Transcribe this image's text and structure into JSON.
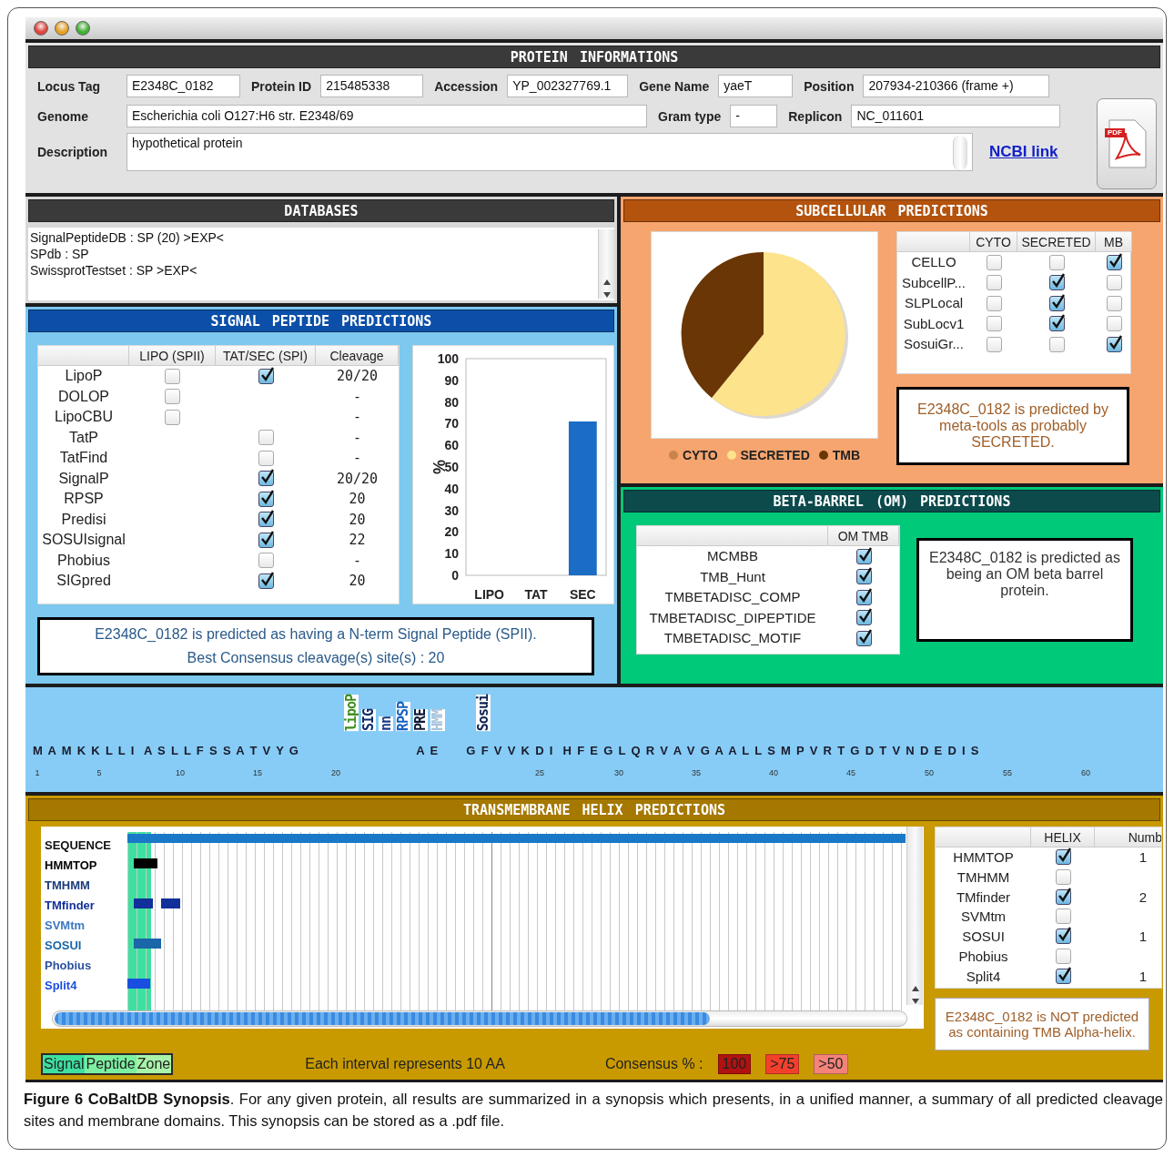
{
  "protein_info": {
    "title": "PROTEIN INFORMATIONS",
    "rows": [
      {
        "fields": [
          {
            "label": "Locus Tag",
            "value": "E2348C_0182"
          },
          {
            "label": "Protein ID",
            "value": "215485338"
          },
          {
            "label": "Accession",
            "value": "YP_002327769.1"
          },
          {
            "label": "Gene Name",
            "value": "yaeT"
          },
          {
            "label": "Position",
            "value": "207934-210366 (frame +)"
          }
        ]
      },
      {
        "fields": [
          {
            "label": "Genome",
            "value": "Escherichia coli O127:H6 str. E2348/69"
          },
          {
            "label": "Gram type",
            "value": "-"
          },
          {
            "label": "Replicon",
            "value": "NC_011601"
          }
        ]
      }
    ],
    "description": {
      "label": "Description",
      "value": "hypothetical protein"
    },
    "link": "NCBI link",
    "pdf_badge": "PDF"
  },
  "databases": {
    "title": "DATABASES",
    "lines": [
      "SignalPeptideDB : SP (20) >EXP<",
      "SPdb : SP",
      "SwissprotTestset : SP >EXP<"
    ]
  },
  "signal_peptide": {
    "title": "SIGNAL PEPTIDE PREDICTIONS",
    "columns": [
      "LIPO (SPII)",
      "TAT/SEC (SPI)",
      "Cleavage"
    ],
    "rows": [
      {
        "name": "LipoP",
        "lipo": false,
        "tat_sec": true,
        "cleavage": "20/20"
      },
      {
        "name": "DOLOP",
        "lipo": false,
        "cleavage": "-"
      },
      {
        "name": "LipoCBU",
        "lipo": false,
        "cleavage": "-"
      },
      {
        "name": "TatP",
        "tat_sec": false,
        "cleavage": "-"
      },
      {
        "name": "TatFind",
        "tat_sec": false,
        "cleavage": "-"
      },
      {
        "name": "SignalP",
        "tat_sec": true,
        "cleavage": "20/20"
      },
      {
        "name": "RPSP",
        "tat_sec": true,
        "cleavage": "20"
      },
      {
        "name": "Predisi",
        "tat_sec": true,
        "cleavage": "20"
      },
      {
        "name": "SOSUIsignal",
        "tat_sec": true,
        "cleavage": "22"
      },
      {
        "name": "Phobius",
        "tat_sec": false,
        "cleavage": "-"
      },
      {
        "name": "SIGpred",
        "tat_sec": true,
        "cleavage": "20"
      }
    ],
    "chart_data": {
      "type": "bar",
      "ylabel": "%",
      "categories": [
        "LIPO",
        "TAT",
        "SEC"
      ],
      "values": [
        0,
        0,
        71
      ],
      "ylim": [
        0,
        100
      ],
      "yticks": [
        0,
        10,
        20,
        30,
        40,
        50,
        60,
        70,
        80,
        90,
        100
      ]
    },
    "summary": [
      "E2348C_0182 is predicted as having a N-term Signal Peptide (SPII).",
      "Best Consensus cleavage(s) site(s) : 20"
    ]
  },
  "subcellular": {
    "title": "SUBCELLULAR PREDICTIONS",
    "legend": [
      {
        "label": "CYTO",
        "color": "#c8844a"
      },
      {
        "label": "SECRETED",
        "color": "#fde38c"
      },
      {
        "label": "TMB",
        "color": "#6a3606"
      }
    ],
    "columns": [
      "CYTO",
      "SECRETED",
      "MB"
    ],
    "rows": [
      {
        "name": "CELLO",
        "cyto": false,
        "secreted": false,
        "mb": true
      },
      {
        "name": "SubcellP...",
        "cyto": false,
        "secreted": true,
        "mb": false
      },
      {
        "name": "SLPLocal",
        "cyto": false,
        "secreted": true,
        "mb": false
      },
      {
        "name": "SubLocv1",
        "cyto": false,
        "secreted": true,
        "mb": false
      },
      {
        "name": "SosuiGr...",
        "cyto": false,
        "secreted": false,
        "mb": true
      }
    ],
    "summary": "E2348C_0182 is predicted by meta-tools as probably SECRETED."
  },
  "beta_barrel": {
    "title": "BETA-BARREL (OM) PREDICTIONS",
    "column": "OM TMB",
    "rows": [
      {
        "name": "MCMBB",
        "om_tmb": true
      },
      {
        "name": "TMB_Hunt",
        "om_tmb": true
      },
      {
        "name": "TMBETADISC_COMP",
        "om_tmb": true
      },
      {
        "name": "TMBETADISC_DIPEPTIDE",
        "om_tmb": true
      },
      {
        "name": "TMBETADISC_MOTIF",
        "om_tmb": true
      }
    ],
    "summary": "E2348C_0182 is predicted as being an OM beta barrel protein."
  },
  "sequence": {
    "predictor_marks": [
      {
        "label": "lipoP",
        "color": "#3f8f1e"
      },
      {
        "label": "SIG",
        "color": "#0c2a6a"
      },
      {
        "label": "nn",
        "color": "#1a3a8a"
      },
      {
        "label": "RPSP",
        "color": "#1560c0"
      },
      {
        "label": "PRE",
        "color": "#101a3a"
      },
      {
        "label": "HMM",
        "color": "#a8c4dc"
      },
      {
        "label": "Sosui",
        "color": "#0c2050"
      }
    ],
    "segments": [
      "M A M K K L L I  A S L L F S S A T V Y G",
      "A E",
      "G F V V K D I  H F E G L Q R V A V G A A L L S M P V R T G D T V N D E D I S"
    ],
    "positions": [
      "1",
      "5",
      "10",
      "15",
      "20",
      "25",
      "30",
      "35",
      "40",
      "45",
      "50",
      "55",
      "60"
    ]
  },
  "tm_helix": {
    "title": "TRANSMEMBRANE HELIX PREDICTIONS",
    "tracks": [
      {
        "label": "SEQUENCE",
        "color": "#1a78c8"
      },
      {
        "label": "HMMTOP",
        "color": "#000000"
      },
      {
        "label": "TMHMM",
        "color": "#1a3a7a"
      },
      {
        "label": "TMfinder",
        "color": "#12309a"
      },
      {
        "label": "SVMtm",
        "color": "#3a78c0"
      },
      {
        "label": "SOSUI",
        "color": "#1a66a8"
      },
      {
        "label": "Phobius",
        "color": "#2a50a0"
      },
      {
        "label": "Split4",
        "color": "#1a4ee0"
      }
    ],
    "columns": [
      "HELIX",
      "Numb"
    ],
    "rows": [
      {
        "name": "HMMTOP",
        "helix": true,
        "number": "1"
      },
      {
        "name": "TMHMM",
        "helix": false
      },
      {
        "name": "TMfinder",
        "helix": true,
        "number": "2"
      },
      {
        "name": "SVMtm",
        "helix": false
      },
      {
        "name": "SOSUI",
        "helix": true,
        "number": "1"
      },
      {
        "name": "Phobius",
        "helix": false
      },
      {
        "name": "Split4",
        "helix": true,
        "number": "1"
      }
    ],
    "summary": "E2348C_0182 is NOT predicted as containing TMB Alpha-helix.",
    "zone_legend": [
      {
        "label": "Signal",
        "color": "#3ee0a0"
      },
      {
        "label": "Peptide",
        "color": "#7cf0a0"
      },
      {
        "label": "Zone",
        "color": "#a8f4a8"
      }
    ],
    "interval_note": "Each interval represents 10 AA",
    "consensus_label": "Consensus % :",
    "consensus": [
      {
        "label": "100",
        "color": "#b01212"
      },
      {
        "label": ">75",
        "color": "#f2402c"
      },
      {
        "label": ">50",
        "color": "#f4837a"
      }
    ]
  },
  "caption": "**Figure 6 CoBaltDB Synopsis**. For any given protein, all results are summarized in a synopsis which presents, in a unified manner, a summary of all predicted cleavage sites and membrane domains. This synopsis can be stored as a .pdf file."
}
